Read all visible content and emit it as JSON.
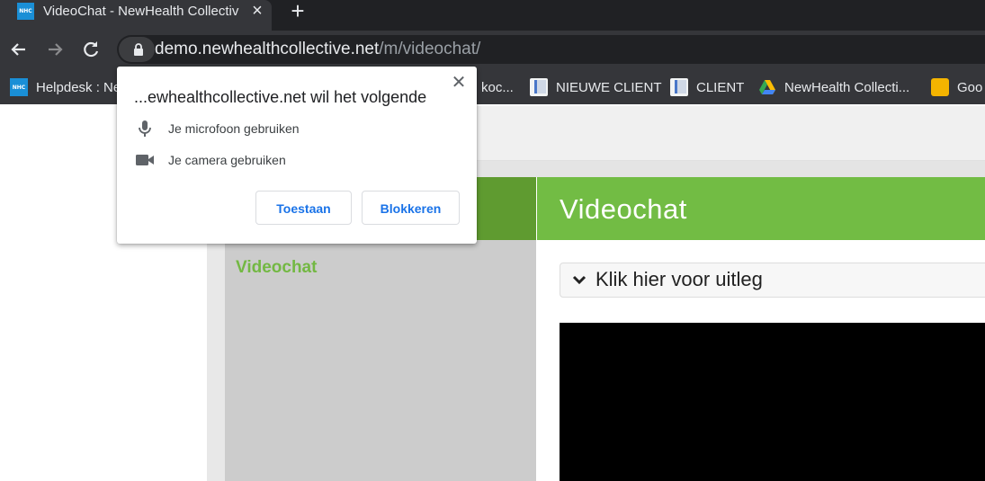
{
  "browser": {
    "tab": {
      "favicon_text": "NHC",
      "title": "VideoChat - NewHealth Collective"
    },
    "url": {
      "host": "demo.newhealthcollective.net",
      "path": "/m/videochat/"
    },
    "bookmarks": [
      {
        "label": "Helpdesk : Ne",
        "icon": "nhc-icon"
      },
      {
        "label": "koc...",
        "icon": "doc-icon"
      },
      {
        "label": "NIEUWE CLIENT",
        "icon": "doc-icon"
      },
      {
        "label": "CLIENT",
        "icon": "doc-icon"
      },
      {
        "label": "NewHealth Collecti...",
        "icon": "drive-icon"
      },
      {
        "label": "Goo",
        "icon": "ideas-icon"
      }
    ]
  },
  "popup": {
    "title": "...ewhealthcollective.net wil het volgende",
    "permissions": [
      {
        "label": "Je microfoon gebruiken",
        "icon": "microphone-icon"
      },
      {
        "label": "Je camera gebruiken",
        "icon": "camera-icon"
      }
    ],
    "allow_label": "Toestaan",
    "block_label": "Blokkeren"
  },
  "page": {
    "header_title": "Videochat",
    "sidebar_item": "Videochat",
    "explain_label": "Klik hier voor uitleg"
  },
  "colors": {
    "header_green": "#72bc44",
    "sidebar_head_green": "#5f9b30",
    "link_green": "#73b843",
    "button_blue": "#1a73e8",
    "chrome_dark": "#35363a"
  }
}
